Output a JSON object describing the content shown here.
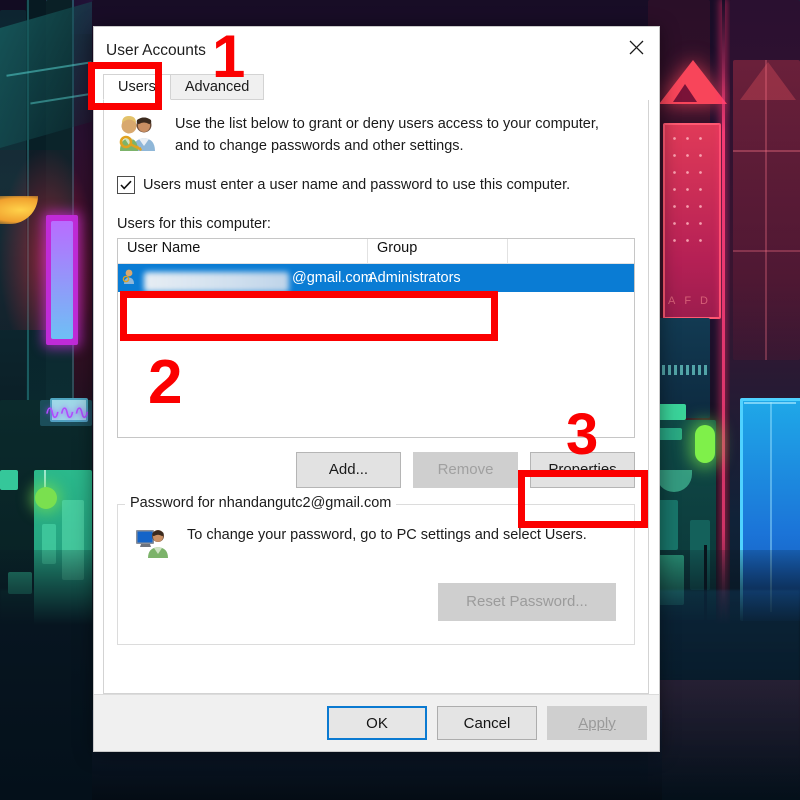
{
  "window": {
    "title": "User Accounts",
    "close_icon": "close-x-icon"
  },
  "tabs": [
    {
      "label": "Users",
      "active": true
    },
    {
      "label": "Advanced",
      "active": false
    }
  ],
  "intro": {
    "icon": "users-with-key-icon",
    "line1": "Use the list below to grant or deny users access to your computer,",
    "line2": "and to change passwords and other settings."
  },
  "checkbox": {
    "label": "Users must enter a user name and password to use this computer.",
    "checked": true,
    "check_icon": "checkmark-icon"
  },
  "list": {
    "caption": "Users for this computer:",
    "columns": [
      "User Name",
      "Group"
    ],
    "rows": [
      {
        "icon": "user-small-icon",
        "user_name_visible": "@gmail.com",
        "user_name_redacted": true,
        "group": "Administrators",
        "selected": true
      }
    ]
  },
  "list_buttons": {
    "add": "Add...",
    "remove": "Remove",
    "properties": "Properties",
    "remove_enabled": false,
    "properties_enabled": true
  },
  "password_group": {
    "legend": "Password for nhandangutc2@gmail.com",
    "icon": "user-monitor-icon",
    "message": "To change your password, go to PC settings and select Users.",
    "reset_button": "Reset Password...",
    "reset_enabled": false
  },
  "footer": {
    "ok": "OK",
    "cancel": "Cancel",
    "apply": "Apply",
    "apply_enabled": false
  },
  "annotations": {
    "markers": [
      {
        "number": "1",
        "target": "users-tab"
      },
      {
        "number": "2",
        "target": "user-row"
      },
      {
        "number": "3",
        "target": "properties-button"
      }
    ]
  },
  "colors": {
    "accent_selection": "#0a7cd4",
    "annotation_red": "#fb0000",
    "focus_blue": "#0b7ad1",
    "dialog_bg": "#ffffff",
    "footer_bg": "#f0f0f0"
  }
}
